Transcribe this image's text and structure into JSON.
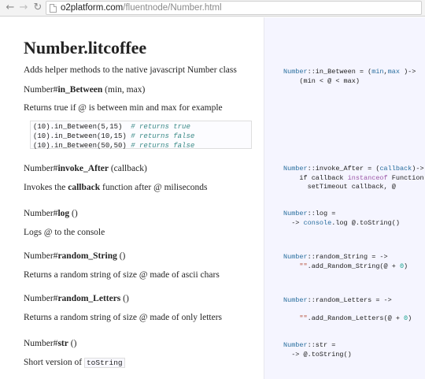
{
  "browser": {
    "url_host": "o2platform.com",
    "url_path": "/fluentnode/Number.html",
    "back_icon": "back-arrow-icon",
    "forward_icon": "forward-arrow-icon",
    "reload_icon": "reload-icon"
  },
  "doc": {
    "title": "Number.litcoffee",
    "intro": "Adds helper methods to the native javascript Number class",
    "sections": [
      {
        "prefix": "Number#",
        "name": "in_Between",
        "args": " (min, max)",
        "desc": "Returns true if @ is between min and max for example"
      },
      {
        "prefix": "Number#",
        "name": "invoke_After",
        "args": " (callback)",
        "desc_before": "Invokes the ",
        "desc_bold": "callback",
        "desc_after": " function after @ miliseconds"
      },
      {
        "prefix": "Number#",
        "name": "log",
        "args": " ()",
        "desc": "Logs @ to the console"
      },
      {
        "prefix": "Number#",
        "name": "random_String",
        "args": " ()",
        "desc": "Returns a random string of size @ made of ascii chars"
      },
      {
        "prefix": "Number#",
        "name": "random_Letters",
        "args": " ()",
        "desc": "Returns a random string of size @ made of only letters"
      },
      {
        "prefix": "Number#",
        "name": "str",
        "args": " ()",
        "desc_before": "Short version of ",
        "desc_code": "toString"
      }
    ],
    "example": [
      {
        "code": "(10).in_Between(5,15)",
        "comment": "# returns true"
      },
      {
        "code": "(10).in_Between(10,15)",
        "comment": "# returns false"
      },
      {
        "code": "(10).in_Between(50,50)",
        "comment": "# returns false"
      }
    ]
  },
  "code": {
    "in_between": [
      "Number",
      "::in_Between = (",
      "min",
      ",",
      "max",
      " )->",
      "(min < @ < max)"
    ],
    "invoke_after": [
      "Number",
      "::invoke_After = (",
      "callback",
      ")->",
      "if callback ",
      "instanceof",
      " Function",
      "setTimeout callback, @"
    ],
    "log": [
      "Number",
      "::log =",
      "-> ",
      "console",
      ".log @.toString()"
    ],
    "random_string": [
      "Number",
      "::random_String = ->",
      "\"\"",
      ".add_Random_String(@ + ",
      "0",
      ")"
    ],
    "random_letters": [
      "Number",
      "::random_Letters = ->",
      "\"\"",
      ".add_Random_Letters(@ + ",
      "0",
      ")"
    ],
    "str": [
      "Number",
      "::str =",
      "-> @.toString()"
    ]
  },
  "colors": {
    "code_pane_bg": "#f5f5ff",
    "keyword": "#2a6f9f",
    "number": "#0f9f8a",
    "string": "#b44b33",
    "comment": "#3a8a87"
  }
}
